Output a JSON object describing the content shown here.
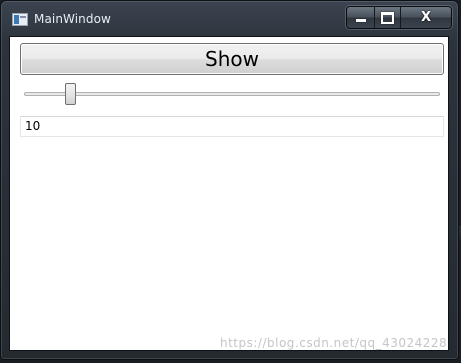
{
  "window": {
    "title": "MainWindow",
    "icon": "wpf-window-icon",
    "caption": {
      "minimize": "minimize-icon",
      "maximize": "maximize-icon",
      "close_glyph": "X"
    }
  },
  "content": {
    "show_button_label": "Show",
    "slider": {
      "minimum": 0,
      "maximum": 100,
      "value": 10
    },
    "value_text": "10"
  },
  "watermark": "https://blog.csdn.net/qq_43024228",
  "colors": {
    "client_background": "#ffffff",
    "button_border": "#707070",
    "frame": "#2c333c"
  }
}
